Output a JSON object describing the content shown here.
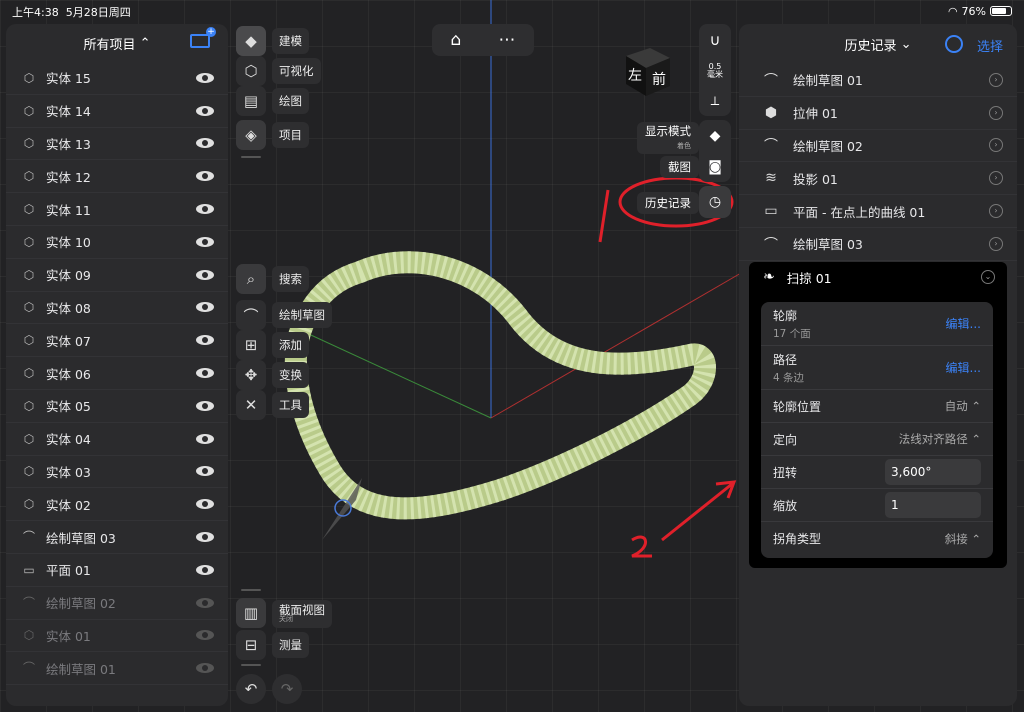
{
  "status": {
    "time": "上午4:38",
    "date": "5月28日周四",
    "battery": "76%"
  },
  "left_panel": {
    "title": "所有项目",
    "items": [
      {
        "label": "实体  15",
        "icon": "cube-icon",
        "dim": false
      },
      {
        "label": "实体  14",
        "icon": "cube-icon",
        "dim": false
      },
      {
        "label": "实体  13",
        "icon": "cube-icon",
        "dim": false
      },
      {
        "label": "实体  12",
        "icon": "cube-icon",
        "dim": false
      },
      {
        "label": "实体  11",
        "icon": "cube-icon",
        "dim": false
      },
      {
        "label": "实体  10",
        "icon": "cube-icon",
        "dim": false
      },
      {
        "label": "实体  09",
        "icon": "cube-icon",
        "dim": false
      },
      {
        "label": "实体  08",
        "icon": "cube-icon",
        "dim": false
      },
      {
        "label": "实体  07",
        "icon": "cube-icon",
        "dim": false
      },
      {
        "label": "实体  06",
        "icon": "cube-icon",
        "dim": false
      },
      {
        "label": "实体  05",
        "icon": "cube-icon",
        "dim": false
      },
      {
        "label": "实体  04",
        "icon": "cube-icon",
        "dim": false
      },
      {
        "label": "实体  03",
        "icon": "cube-icon",
        "dim": false
      },
      {
        "label": "实体  02",
        "icon": "cube-icon",
        "dim": false
      },
      {
        "label": "绘制草图 03",
        "icon": "sketch-icon",
        "dim": false
      },
      {
        "label": "平面  01",
        "icon": "plane-icon",
        "dim": false
      },
      {
        "label": "绘制草图 02",
        "icon": "sketch-icon",
        "dim": true
      },
      {
        "label": "实体  01",
        "icon": "cube-icon",
        "dim": true
      },
      {
        "label": "绘制草图 01",
        "icon": "sketch-icon",
        "dim": true
      }
    ]
  },
  "toolbar": {
    "model": "建模",
    "visualize": "可视化",
    "drawing": "绘图",
    "project": "项目",
    "search": "搜索",
    "sketch": "绘制草图",
    "add": "添加",
    "transform": "变换",
    "tools": "工具",
    "section_view": "截面视图",
    "section_state": "关闭",
    "measure": "测量"
  },
  "view_tools": {
    "units_value": "0.5",
    "units_label": "毫米",
    "display_mode": "显示模式",
    "display_sub": "着色",
    "screenshot": "截图",
    "history": "历史记录",
    "cube_left": "左",
    "cube_front": "前"
  },
  "right_panel": {
    "title": "历史记录",
    "select": "选择",
    "items": [
      {
        "label": "绘制草图 01",
        "icon": "sketch-icon"
      },
      {
        "label": "拉伸 01",
        "icon": "extrude-icon"
      },
      {
        "label": "绘制草图 02",
        "icon": "sketch-icon"
      },
      {
        "label": "投影 01",
        "icon": "project-icon"
      },
      {
        "label": "平面  - 在点上的曲线 01",
        "icon": "plane-icon"
      },
      {
        "label": "绘制草图 03",
        "icon": "sketch-icon"
      }
    ],
    "sweep": {
      "title": "扫掠 01",
      "profile_label": "轮廓",
      "profile_sub": "17 个面",
      "profile_edit": "编辑...",
      "path_label": "路径",
      "path_sub": "4 条边",
      "path_edit": "编辑...",
      "profile_pos_label": "轮廓位置",
      "profile_pos_value": "自动 ⌃",
      "orient_label": "定向",
      "orient_value": "法线对齐路径 ⌃",
      "twist_label": "扭转",
      "twist_value": "3,600°",
      "scale_label": "缩放",
      "scale_value": "1",
      "corner_label": "拐角类型",
      "corner_value": "斜接 ⌃"
    }
  },
  "annotations": {
    "mark1": "1",
    "mark2": "2"
  },
  "colors": {
    "accent": "#3b82f6",
    "rope": "#c9d9a0",
    "annotation": "#e0202a"
  }
}
